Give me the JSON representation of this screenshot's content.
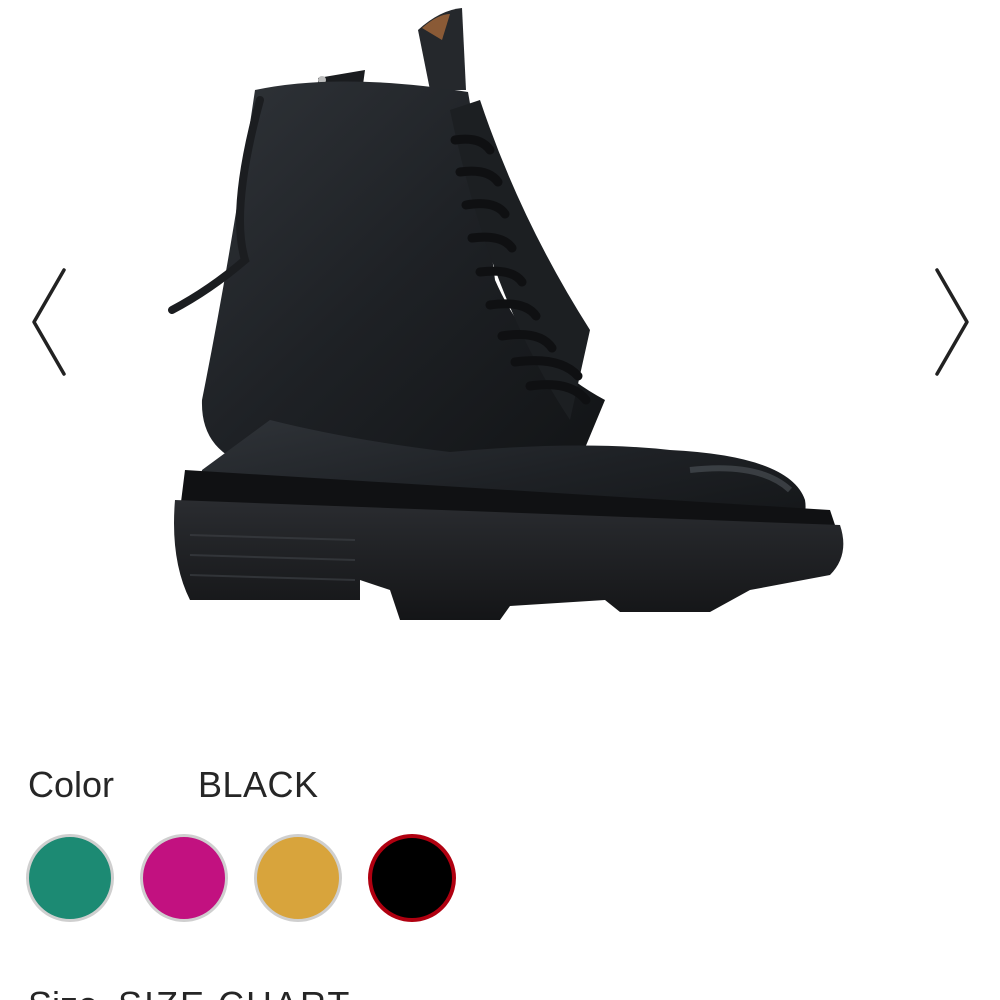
{
  "product": {
    "image_alt": "black lace-up leather combat boot"
  },
  "gallery": {
    "prev_icon": "chevron-left-icon",
    "next_icon": "chevron-right-icon"
  },
  "color": {
    "label": "Color",
    "selected": "BLACK",
    "swatches": [
      {
        "name": "teal",
        "hex": "#1c8a73"
      },
      {
        "name": "magenta",
        "hex": "#c21180"
      },
      {
        "name": "mustard",
        "hex": "#d8a43c"
      },
      {
        "name": "black",
        "hex": "#000000",
        "selected": true
      }
    ]
  },
  "size": {
    "label": "Size",
    "chart_link": "SIZE CHART"
  },
  "colors": {
    "text": "#262626",
    "selected_ring": "#b00010",
    "swatch_ring": "#cfcfcf"
  }
}
